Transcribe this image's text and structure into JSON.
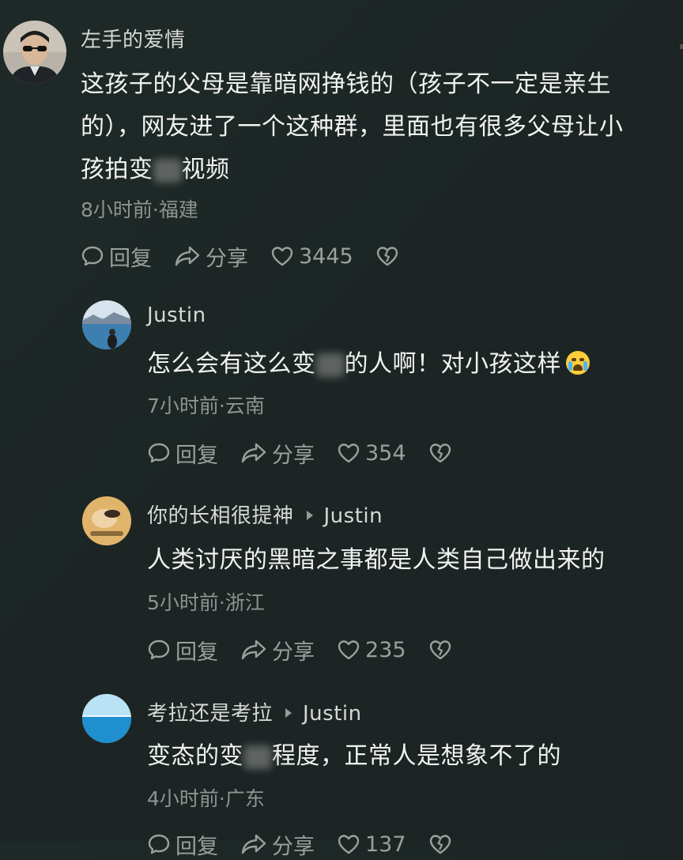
{
  "comments": [
    {
      "username": "左手的爱情",
      "text_lines": [
        "这孩子的父母是靠暗网挣钱的（孩子不一定是亲生",
        "的），网友进了一个这种群，里面也有很多父母让小",
        "孩拍变",
        "视频"
      ],
      "meta": "8小时前·福建",
      "reply_label": "回复",
      "share_label": "分享",
      "likes": "3445"
    },
    {
      "username": "Justin",
      "text_before_blur": "怎么会有这么变",
      "text_after_blur": "的人啊！对小孩这样",
      "meta": "7小时前·云南",
      "reply_label": "回复",
      "share_label": "分享",
      "likes": "354"
    },
    {
      "username": "你的长相很提神",
      "reply_to": "Justin",
      "text": "人类讨厌的黑暗之事都是人类自己做出来的",
      "meta": "5小时前·浙江",
      "reply_label": "回复",
      "share_label": "分享",
      "likes": "235"
    },
    {
      "username": "考拉还是考拉",
      "reply_to": "Justin",
      "text_before_blur": "变态的变",
      "text_after_blur": "程度，正常人是想象不了的",
      "meta": "4小时前·广东",
      "reply_label": "回复",
      "share_label": "分享",
      "likes": "137"
    }
  ],
  "colors": {
    "background": "#1f2a28",
    "text": "#f2f2f2",
    "muted": "#8f9392"
  },
  "icons": [
    "comment-bubble-icon",
    "share-arrow-icon",
    "heart-icon",
    "broken-heart-icon",
    "reply-arrow-icon",
    "crying-emoji-icon"
  ]
}
